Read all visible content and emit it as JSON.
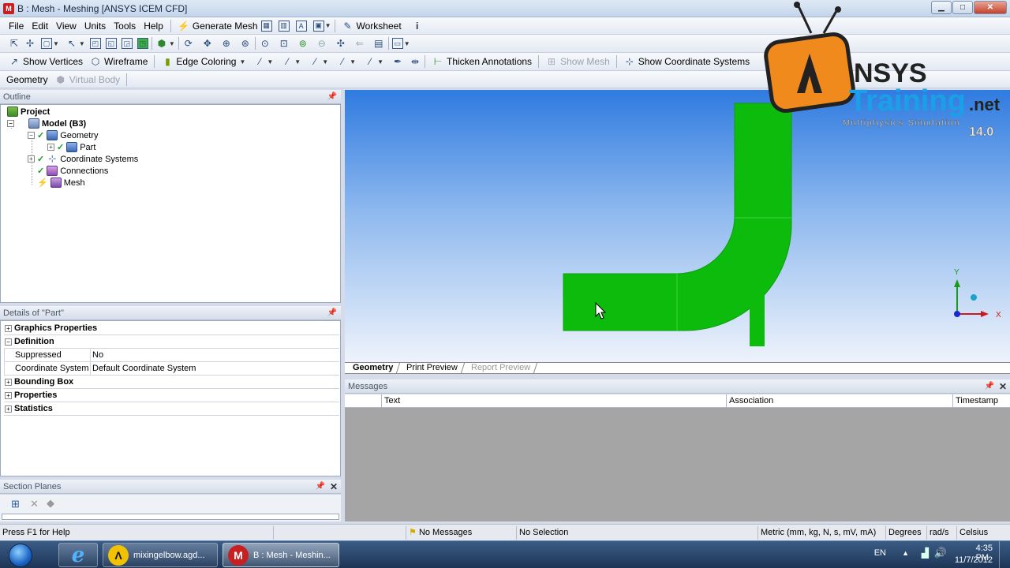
{
  "window": {
    "title": "B : Mesh - Meshing [ANSYS ICEM CFD]",
    "min": "▁",
    "max": "□",
    "close": "✕"
  },
  "menu": [
    "File",
    "Edit",
    "View",
    "Units",
    "Tools",
    "Help"
  ],
  "toolbar1": {
    "generate_mesh": "Generate Mesh",
    "worksheet": "Worksheet"
  },
  "toolbar2": {
    "show_vertices": "Show Vertices",
    "wireframe": "Wireframe",
    "edge_coloring": "Edge Coloring",
    "thicken_annotations": "Thicken Annotations",
    "show_mesh": "Show Mesh",
    "show_coordinate_systems": "Show Coordinate Systems"
  },
  "toolbar3": {
    "geometry": "Geometry",
    "virtual_body": "Virtual Body"
  },
  "outline": {
    "title": "Outline",
    "nodes": [
      "Project",
      "Model (B3)",
      "Geometry",
      "Part",
      "Coordinate Systems",
      "Connections",
      "Mesh"
    ]
  },
  "details": {
    "title": "Details of \"Part\"",
    "groups": {
      "graphics": "Graphics Properties",
      "definition": "Definition",
      "bounding": "Bounding Box",
      "properties": "Properties",
      "statistics": "Statistics"
    },
    "rows": [
      {
        "key": "Suppressed",
        "value": "No"
      },
      {
        "key": "Coordinate System",
        "value": "Default Coordinate System"
      }
    ]
  },
  "section_planes": {
    "title": "Section Planes"
  },
  "view_tabs": [
    "Geometry",
    "Print Preview",
    "Report Preview"
  ],
  "axes": {
    "x": "X",
    "y": "Y"
  },
  "messages": {
    "title": "Messages",
    "columns": [
      "Text",
      "Association",
      "Timestamp"
    ]
  },
  "status": {
    "help": "Press F1 for Help",
    "messages": "No Messages",
    "selection": "No Selection",
    "units": "Metric (mm, kg, N, s, mV, mA)",
    "angle": "Degrees",
    "rate": "rad/s",
    "temp": "Celsius"
  },
  "taskbar": {
    "tasks": [
      "mixingelbow.agd...",
      "B : Mesh - Meshin..."
    ],
    "lang": "EN",
    "time": "4:35 PM",
    "date": "11/7/2012"
  },
  "watermark": {
    "brand_a": "NSYS",
    "brand_b": "Training",
    "brand_c": ".net",
    "tagline": "Multiphysics Simulation",
    "version": "14.0"
  },
  "colors": {
    "geometry_green": "#0dbb0d",
    "viewport_top": "#2f7be0",
    "accent_orange": "#f08a1c"
  }
}
